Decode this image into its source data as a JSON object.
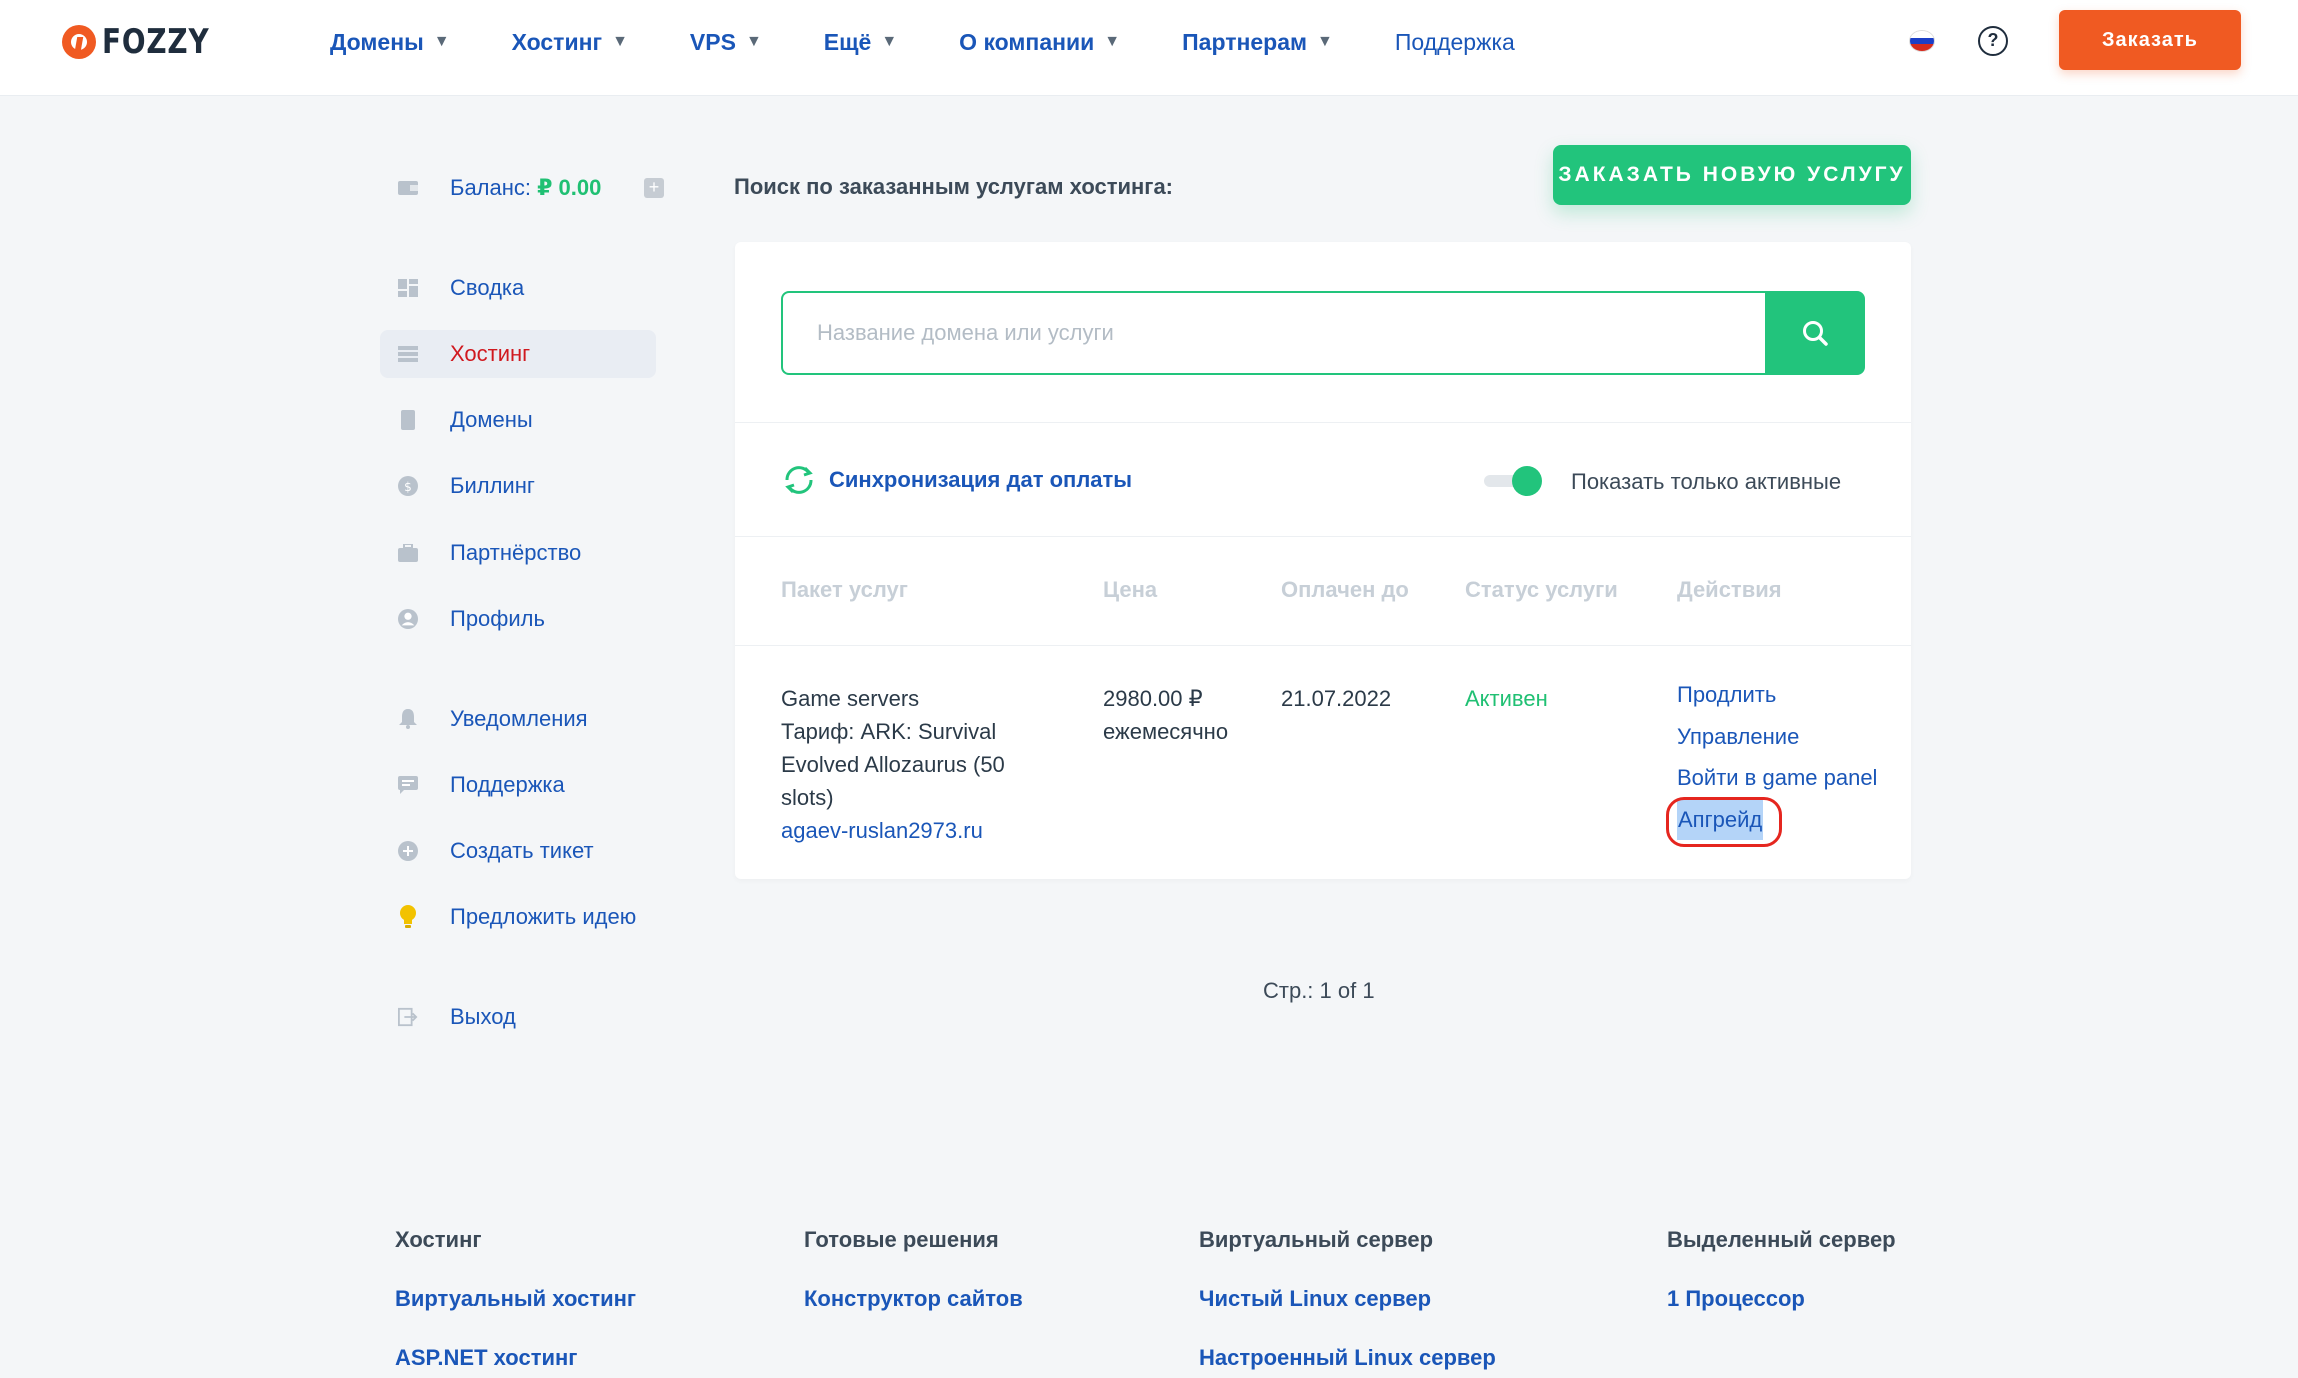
{
  "header": {
    "logo_text": "FOZZY",
    "nav": [
      {
        "label": "Домены",
        "has_dropdown": true
      },
      {
        "label": "Хостинг",
        "has_dropdown": true
      },
      {
        "label": "VPS",
        "has_dropdown": true
      },
      {
        "label": "Ещё",
        "has_dropdown": true
      },
      {
        "label": "О компании",
        "has_dropdown": true
      },
      {
        "label": "Партнерам",
        "has_dropdown": true
      },
      {
        "label": "Поддержка",
        "has_dropdown": false
      }
    ],
    "help_glyph": "?",
    "order_button": "Заказать",
    "flag_colors": [
      "#ffffff",
      "#1c3fc7",
      "#d52b1e"
    ]
  },
  "sidebar": {
    "balance_label": "Баланс:",
    "balance_amount": "₽ 0.00",
    "items": [
      {
        "label": "Сводка",
        "icon": "dashboard-icon"
      },
      {
        "label": "Хостинг",
        "icon": "server-icon",
        "active": true
      },
      {
        "label": "Домены",
        "icon": "document-icon"
      },
      {
        "label": "Биллинг",
        "icon": "coin-icon"
      },
      {
        "label": "Партнёрство",
        "icon": "briefcase-icon"
      },
      {
        "label": "Профиль",
        "icon": "user-icon"
      },
      {
        "label": "Уведомления",
        "icon": "bell-icon"
      },
      {
        "label": "Поддержка",
        "icon": "chat-icon"
      },
      {
        "label": "Создать тикет",
        "icon": "plus-circle-icon"
      },
      {
        "label": "Предложить идею",
        "icon": "lightbulb-icon"
      },
      {
        "label": "Выход",
        "icon": "logout-icon"
      }
    ]
  },
  "main": {
    "search_title": "Поиск по заказанным услугам хостинга:",
    "new_service_button": "ЗАКАЗАТЬ НОВУЮ УСЛУГУ",
    "search_placeholder": "Название домена или услуги",
    "sync_label": "Синхронизация дат оплаты",
    "toggle_label": "Показать только активные",
    "toggle_on": true,
    "columns": [
      "Пакет услуг",
      "Цена",
      "Оплачен до",
      "Статус услуги",
      "Действия"
    ],
    "row": {
      "package_lines": [
        "Game servers",
        "Тариф: ARK: Survival",
        "Evolved Allozaurus (50",
        "slots)"
      ],
      "package_domain": "agaev-ruslan2973.ru",
      "price": "2980.00 ₽",
      "period": "ежемесячно",
      "paid_until": "21.07.2022",
      "status": "Активен",
      "actions": [
        "Продлить",
        "Управление",
        "Войти в game panel",
        "Апгрейд"
      ]
    },
    "pager": "Стр.: 1 of 1"
  },
  "footer": {
    "columns": [
      {
        "heading": "Хостинг",
        "links": [
          "Виртуальный хостинг",
          "ASP.NET хостинг"
        ]
      },
      {
        "heading": "Готовые решения",
        "links": [
          "Конструктор сайтов"
        ]
      },
      {
        "heading": "Виртуальный сервер",
        "links": [
          "Чистый Linux сервер",
          "Настроенный Linux сервер"
        ]
      },
      {
        "heading": "Выделенный сервер",
        "links": [
          "1 Процессор"
        ]
      }
    ]
  },
  "colors": {
    "brand_orange": "#f05a22",
    "accent_green": "#22c47c",
    "link_blue": "#1a56b8",
    "active_red": "#d0191f",
    "annotation_red": "#e5261f"
  }
}
